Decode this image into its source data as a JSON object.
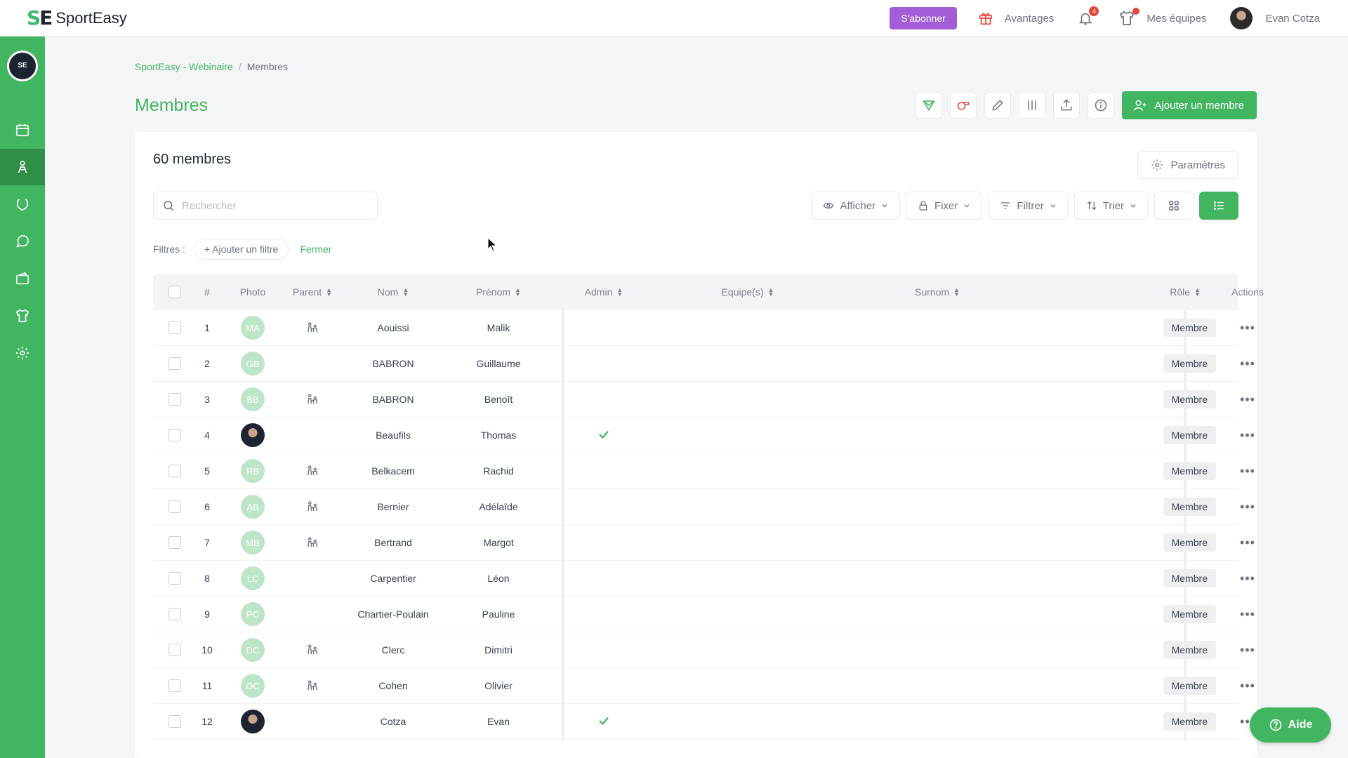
{
  "topbar": {
    "brand_mark_left": "S",
    "brand_mark_right": "E",
    "brand_name": "SportEasy",
    "subscribe": "S'abonner",
    "advantages": "Avantages",
    "notif_count": "4",
    "my_teams": "Mes équipes",
    "user_name": "Evan Cotza"
  },
  "sidebar": {
    "team_logo": "SE"
  },
  "breadcrumb": {
    "parent": "SportEasy - Webinaire",
    "separator": "/",
    "current": "Membres"
  },
  "page": {
    "title": "Membres",
    "add_member": "Ajouter un membre"
  },
  "card": {
    "title": "60 membres",
    "params": "Paramètres",
    "search_placeholder": "Rechercher",
    "toolbar": {
      "afficher": "Afficher",
      "fixer": "Fixer",
      "filtrer": "Filtrer",
      "trier": "Trier"
    },
    "filters_label": "Filtres :",
    "add_filter": "+ Ajouter un filtre",
    "close": "Fermer"
  },
  "table": {
    "headers": {
      "num": "#",
      "photo": "Photo",
      "parent": "Parent",
      "nom": "Nom",
      "prenom": "Prénom",
      "admin": "Admin",
      "equipes": "Equipe(s)",
      "surnom": "Surnom",
      "role": "Rôle",
      "actions": "Actions"
    },
    "rows": [
      {
        "num": "1",
        "initials": "MA",
        "photo": false,
        "parent": true,
        "nom": "Aouissi",
        "prenom": "Malik",
        "admin": false,
        "role": "Membre"
      },
      {
        "num": "2",
        "initials": "GB",
        "photo": false,
        "parent": false,
        "nom": "BABRON",
        "prenom": "Guillaume",
        "admin": false,
        "role": "Membre"
      },
      {
        "num": "3",
        "initials": "BB",
        "photo": false,
        "parent": true,
        "nom": "BABRON",
        "prenom": "Benoît",
        "admin": false,
        "role": "Membre"
      },
      {
        "num": "4",
        "initials": "",
        "photo": true,
        "parent": false,
        "nom": "Beaufils",
        "prenom": "Thomas",
        "admin": true,
        "role": "Membre"
      },
      {
        "num": "5",
        "initials": "RB",
        "photo": false,
        "parent": true,
        "nom": "Belkacem",
        "prenom": "Rachid",
        "admin": false,
        "role": "Membre"
      },
      {
        "num": "6",
        "initials": "AB",
        "photo": false,
        "parent": true,
        "nom": "Bernier",
        "prenom": "Adélaïde",
        "admin": false,
        "role": "Membre"
      },
      {
        "num": "7",
        "initials": "MB",
        "photo": false,
        "parent": true,
        "nom": "Bertrand",
        "prenom": "Margot",
        "admin": false,
        "role": "Membre"
      },
      {
        "num": "8",
        "initials": "LC",
        "photo": false,
        "parent": false,
        "nom": "Carpentier",
        "prenom": "Léon",
        "admin": false,
        "role": "Membre"
      },
      {
        "num": "9",
        "initials": "PC",
        "photo": false,
        "parent": false,
        "nom": "Chartier-Poulain",
        "prenom": "Pauline",
        "admin": false,
        "role": "Membre"
      },
      {
        "num": "10",
        "initials": "DC",
        "photo": false,
        "parent": true,
        "nom": "Clerc",
        "prenom": "Dimitri",
        "admin": false,
        "role": "Membre"
      },
      {
        "num": "11",
        "initials": "OC",
        "photo": false,
        "parent": true,
        "nom": "Cohen",
        "prenom": "Olivier",
        "admin": false,
        "role": "Membre"
      },
      {
        "num": "12",
        "initials": "",
        "photo": true,
        "parent": false,
        "nom": "Cotza",
        "prenom": "Evan",
        "admin": true,
        "role": "Membre"
      }
    ]
  },
  "help": "Aide",
  "colors": {
    "brand_green": "#41b55f",
    "subscribe_purple": "#a35dd8",
    "badge_red": "#e8473d"
  }
}
